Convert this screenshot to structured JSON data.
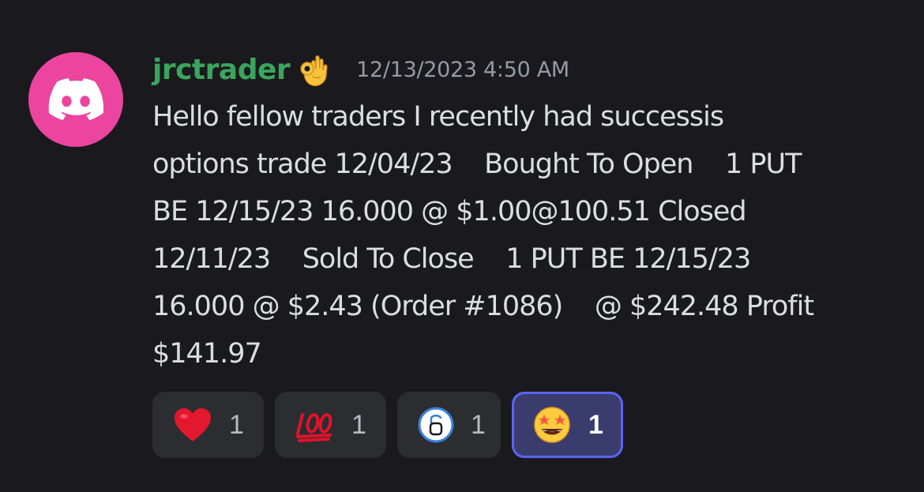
{
  "message": {
    "username": "jrctrader",
    "username_emoji": "ok-hand-emoji",
    "timestamp": "12/13/2023 4:50 AM",
    "lines": [
      "Hello fellow traders I recently had successis",
      "options trade 12/04/23    Bought To Open    1 PUT",
      "BE 12/15/23 16.000 @ $1.00@100.51 Closed",
      "12/11/23    Sold To Close    1 PUT BE 12/15/23",
      "16.000 @ $2.43 (Order #1086)    @ $242.48 Profit",
      "$141.97"
    ]
  },
  "reactions": [
    {
      "icon": "red-heart-emoji",
      "count": "1",
      "active": false
    },
    {
      "icon": "hundred-points-emoji",
      "count": "1",
      "active": false
    },
    {
      "icon": "unlocked-emoji",
      "count": "1",
      "active": false
    },
    {
      "icon": "star-struck-emoji",
      "count": "1",
      "active": true
    }
  ],
  "colors": {
    "background": "#1a1a1e",
    "username": "#3ba55d",
    "avatar": "#eb459f",
    "active_reaction_border": "#5865f2"
  }
}
